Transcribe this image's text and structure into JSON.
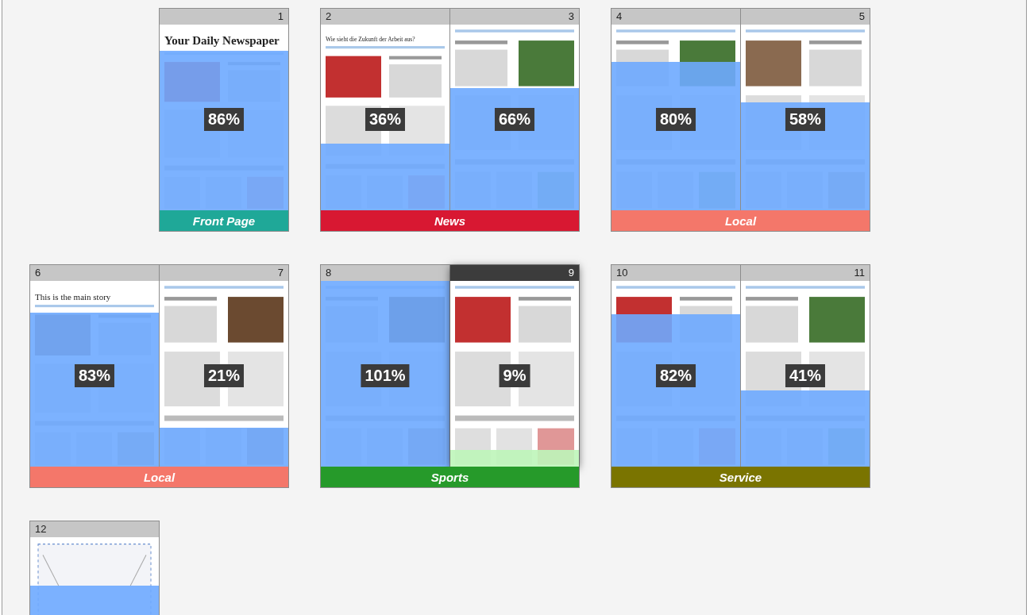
{
  "rows": [
    {
      "spreads": [
        {
          "section": {
            "label": "Front Page",
            "color": "#1fa898"
          },
          "pages": [
            {
              "kind": "blank"
            },
            {
              "kind": "page",
              "number": "1",
              "percent": "86%",
              "level": 0.86,
              "headline": "Your Daily Newspaper",
              "selected": false
            }
          ]
        },
        {
          "section": {
            "label": "News",
            "color": "#d81832"
          },
          "pages": [
            {
              "kind": "page",
              "number": "2",
              "percent": "36%",
              "level": 0.36,
              "headline": "Wie sieht die Zukunft der Arbeit aus?",
              "selected": false
            },
            {
              "kind": "page",
              "number": "3",
              "percent": "66%",
              "level": 0.66,
              "selected": false
            }
          ]
        },
        {
          "section": {
            "label": "Local",
            "color": "#f4776a"
          },
          "pages": [
            {
              "kind": "page",
              "number": "4",
              "percent": "80%",
              "level": 0.8,
              "selected": false
            },
            {
              "kind": "page",
              "number": "5",
              "percent": "58%",
              "level": 0.58,
              "selected": false
            }
          ]
        }
      ]
    },
    {
      "spreads": [
        {
          "section": {
            "label": "Local",
            "color": "#f4776a"
          },
          "pages": [
            {
              "kind": "page",
              "number": "6",
              "percent": "83%",
              "level": 0.83,
              "headline": "This is the main story",
              "selected": false
            },
            {
              "kind": "page",
              "number": "7",
              "percent": "21%",
              "level": 0.21,
              "selected": false
            }
          ]
        },
        {
          "section": {
            "label": "Sports",
            "color": "#269a2a"
          },
          "pages": [
            {
              "kind": "page",
              "number": "8",
              "percent": "101%",
              "level": 1,
              "selected": false
            },
            {
              "kind": "page",
              "number": "9",
              "percent": "9%",
              "level": 0.09,
              "selected": true
            }
          ]
        },
        {
          "section": {
            "label": "Service",
            "color": "#7a7400"
          },
          "pages": [
            {
              "kind": "page",
              "number": "10",
              "percent": "82%",
              "level": 0.82,
              "selected": false
            },
            {
              "kind": "page",
              "number": "11",
              "percent": "41%",
              "level": 0.41,
              "selected": false
            }
          ]
        }
      ]
    },
    {
      "spreads": [
        {
          "pages": [
            {
              "kind": "placeholder",
              "number": "12",
              "level": 0.74,
              "selected": false
            }
          ]
        }
      ]
    }
  ]
}
